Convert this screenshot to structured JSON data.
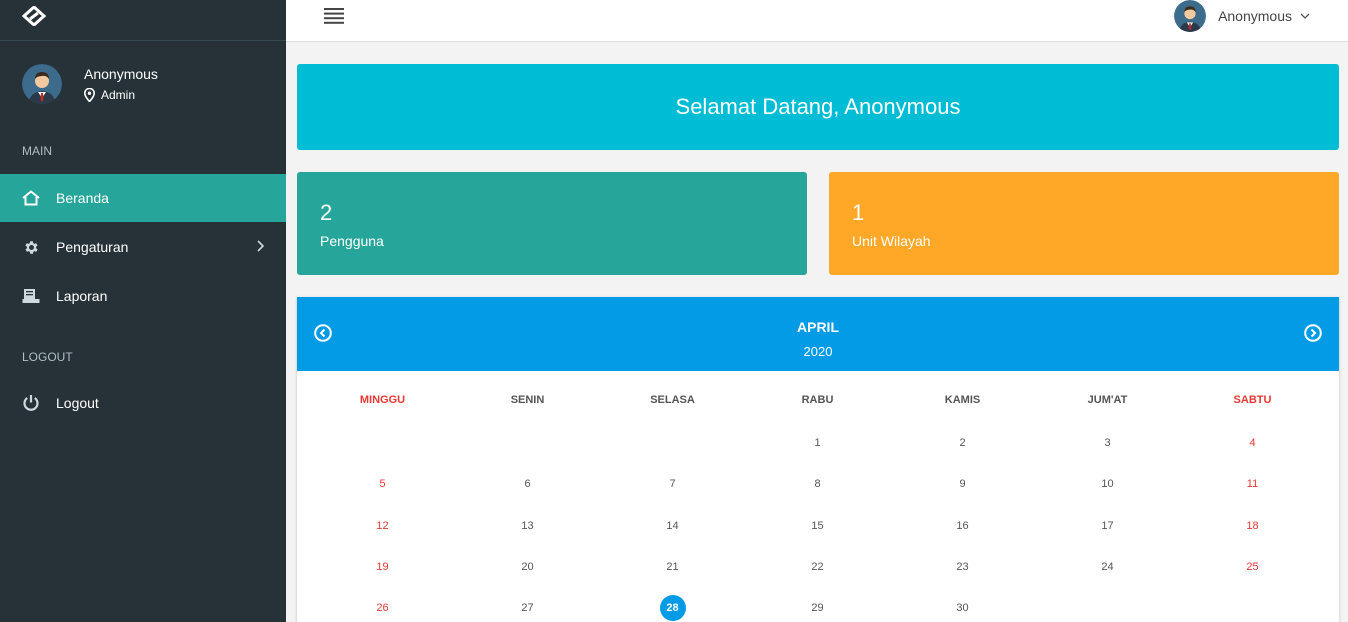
{
  "sidebar": {
    "user_name": "Anonymous",
    "user_role": "Admin",
    "section_main": "MAIN",
    "section_logout": "LOGOUT",
    "items": [
      {
        "label": "Beranda",
        "icon": "home-icon"
      },
      {
        "label": "Pengaturan",
        "icon": "gear-icon"
      },
      {
        "label": "Laporan",
        "icon": "report-icon"
      },
      {
        "label": "Logout",
        "icon": "power-icon"
      }
    ]
  },
  "topbar": {
    "user_name": "Anonymous"
  },
  "welcome": {
    "text": "Selamat Datang, Anonymous"
  },
  "stats": [
    {
      "value": "2",
      "label": "Pengguna",
      "color": "#26a69a"
    },
    {
      "value": "1",
      "label": "Unit Wilayah",
      "color": "#ffa726"
    }
  ],
  "calendar": {
    "month": "APRIL",
    "year": "2020",
    "weekdays": [
      "MINGGU",
      "SENIN",
      "SELASA",
      "RABU",
      "KAMIS",
      "JUM'AT",
      "SABTU"
    ],
    "weeks": [
      [
        "",
        "",
        "",
        "1",
        "2",
        "3",
        "4"
      ],
      [
        "5",
        "6",
        "7",
        "8",
        "9",
        "10",
        "11"
      ],
      [
        "12",
        "13",
        "14",
        "15",
        "16",
        "17",
        "18"
      ],
      [
        "19",
        "20",
        "21",
        "22",
        "23",
        "24",
        "25"
      ],
      [
        "26",
        "27",
        "28",
        "29",
        "30",
        "",
        ""
      ]
    ],
    "today": "28"
  },
  "colors": {
    "sidebar_bg": "#263238",
    "active_item": "#26a69a",
    "welcome_bg": "#00bcd4",
    "calendar_header": "#039be5",
    "weekend_red": "#e53935"
  }
}
